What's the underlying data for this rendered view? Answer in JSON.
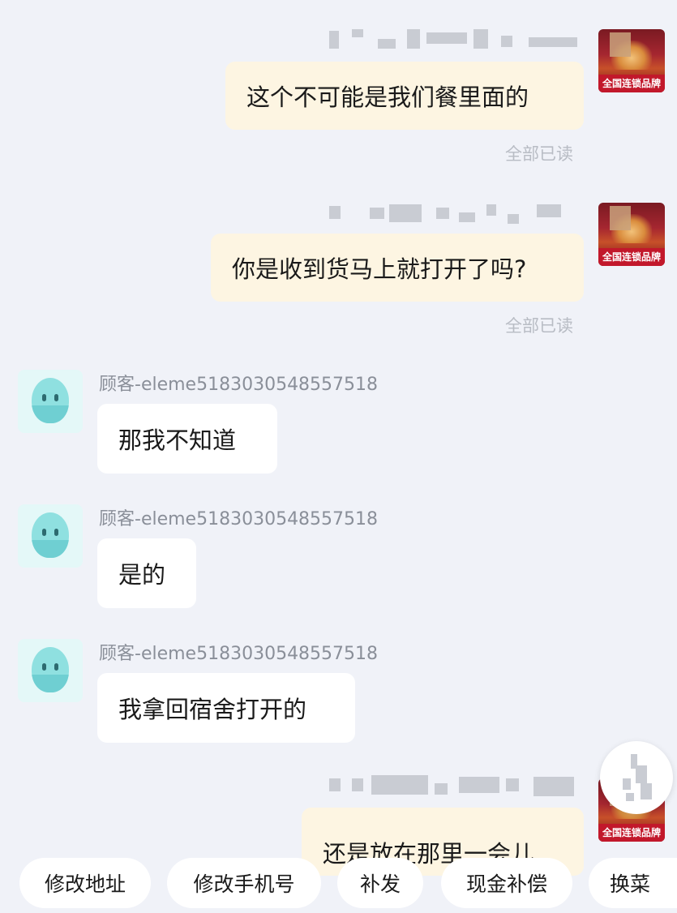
{
  "merchant": {
    "avatar_tag": "全国连锁品牌"
  },
  "messages": [
    {
      "text": "这个不可能是我们餐里面的",
      "status": "全部已读"
    },
    {
      "text": "你是收到货马上就打开了吗?",
      "status": "全部已读"
    },
    {
      "sender": "顾客-eleme5183030548557518",
      "text": "那我不知道"
    },
    {
      "sender": "顾客-eleme5183030548557518",
      "text": "是的"
    },
    {
      "sender": "顾客-eleme5183030548557518",
      "text": "我拿回宿舍打开的"
    },
    {
      "text": "还是放在那里一会儿"
    }
  ],
  "quick_actions": [
    "修改地址",
    "修改手机号",
    "补发",
    "现金补偿",
    "换菜"
  ],
  "colors": {
    "background": "#f0f2f8",
    "outgoing_bubble": "#fdf5e2",
    "incoming_bubble": "#ffffff",
    "read_status": "#b8bcc4",
    "brand_tag": "#c2182b"
  }
}
